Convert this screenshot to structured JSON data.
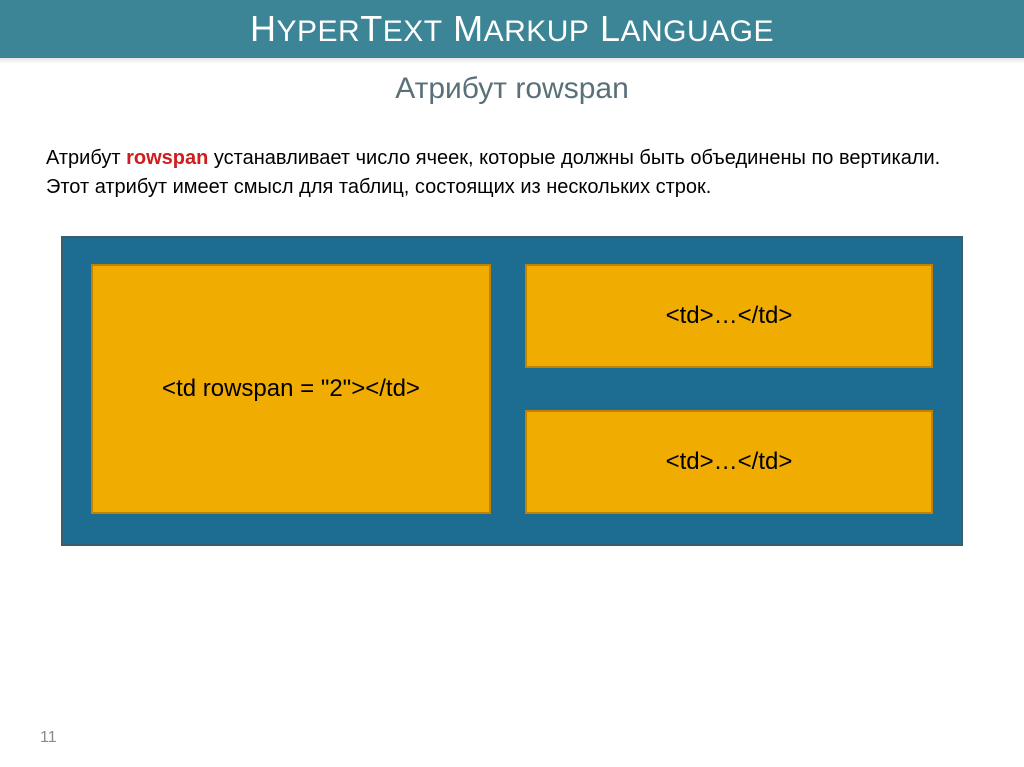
{
  "slide": {
    "title_parts": {
      "h": "H",
      "yper": "YPER",
      "t": "T",
      "ext": "EXT",
      "sp1": " ",
      "m": "M",
      "arkup": "ARKUP",
      "sp2": " ",
      "l": "L",
      "anguage": "ANGUAGE"
    },
    "subtitle": "Атрибут rowspan",
    "body_prefix": "Атрибут ",
    "body_keyword": "rowspan",
    "body_suffix": " устанавливает число ячеек, которые должны быть объединены по вертикали. Этот атрибут имеет смысл для таблиц, состоящих из нескольких строк.",
    "cells": {
      "left": "<td rowspan = \"2\"></td>",
      "right_top": "<td>…</td>",
      "right_bottom": "<td>…</td>"
    },
    "page_number": "11",
    "colors": {
      "band": "#3b8596",
      "outer_box": "#1d6d92",
      "cell_fill": "#f0ac00",
      "keyword": "#d01c1c"
    }
  }
}
